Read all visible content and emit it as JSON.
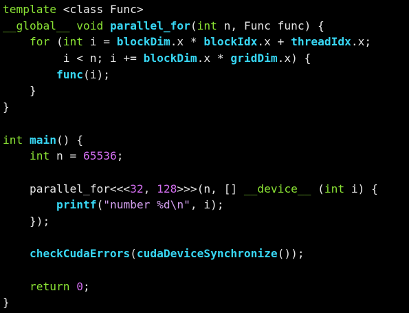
{
  "window": {
    "background": "#000000"
  },
  "colors": {
    "keyword": "#8ae234",
    "function": "#38d8f5",
    "number": "#d36ef0",
    "string": "#d4a0f0",
    "plain": "#e6e6e6"
  },
  "code": {
    "lines": [
      [
        {
          "t": "template",
          "c": "kw"
        },
        {
          "t": " <class Func>",
          "c": "pl"
        }
      ],
      [
        {
          "t": "__global__",
          "c": "kw"
        },
        {
          "t": " ",
          "c": "pl"
        },
        {
          "t": "void",
          "c": "kw"
        },
        {
          "t": " ",
          "c": "pl"
        },
        {
          "t": "parallel_for",
          "c": "fn"
        },
        {
          "t": "(",
          "c": "pl"
        },
        {
          "t": "int",
          "c": "kw"
        },
        {
          "t": " n, Func func) {",
          "c": "pl"
        }
      ],
      [
        {
          "t": "    ",
          "c": "pl"
        },
        {
          "t": "for",
          "c": "kw"
        },
        {
          "t": " (",
          "c": "pl"
        },
        {
          "t": "int",
          "c": "kw"
        },
        {
          "t": " i = ",
          "c": "pl"
        },
        {
          "t": "blockDim",
          "c": "fn"
        },
        {
          "t": ".x * ",
          "c": "pl"
        },
        {
          "t": "blockIdx",
          "c": "fn"
        },
        {
          "t": ".x + ",
          "c": "pl"
        },
        {
          "t": "threadIdx",
          "c": "fn"
        },
        {
          "t": ".x;",
          "c": "pl"
        }
      ],
      [
        {
          "t": "         i < n; i += ",
          "c": "pl"
        },
        {
          "t": "blockDim",
          "c": "fn"
        },
        {
          "t": ".x * ",
          "c": "pl"
        },
        {
          "t": "gridDim",
          "c": "fn"
        },
        {
          "t": ".x) {",
          "c": "pl"
        }
      ],
      [
        {
          "t": "        ",
          "c": "pl"
        },
        {
          "t": "func",
          "c": "fn"
        },
        {
          "t": "(i);",
          "c": "pl"
        }
      ],
      [
        {
          "t": "    }",
          "c": "pl"
        }
      ],
      [
        {
          "t": "}",
          "c": "pl"
        }
      ],
      [
        {
          "t": "",
          "c": "pl"
        }
      ],
      [
        {
          "t": "int",
          "c": "kw"
        },
        {
          "t": " ",
          "c": "pl"
        },
        {
          "t": "main",
          "c": "fn"
        },
        {
          "t": "() {",
          "c": "pl"
        }
      ],
      [
        {
          "t": "    ",
          "c": "pl"
        },
        {
          "t": "int",
          "c": "kw"
        },
        {
          "t": " n = ",
          "c": "pl"
        },
        {
          "t": "65536",
          "c": "num"
        },
        {
          "t": ";",
          "c": "pl"
        }
      ],
      [
        {
          "t": "",
          "c": "pl"
        }
      ],
      [
        {
          "t": "    parallel_for<<<",
          "c": "pl"
        },
        {
          "t": "32",
          "c": "num"
        },
        {
          "t": ", ",
          "c": "pl"
        },
        {
          "t": "128",
          "c": "num"
        },
        {
          "t": ">>>(n, [] ",
          "c": "pl"
        },
        {
          "t": "__device__",
          "c": "kw"
        },
        {
          "t": " (",
          "c": "pl"
        },
        {
          "t": "int",
          "c": "kw"
        },
        {
          "t": " i) {",
          "c": "pl"
        }
      ],
      [
        {
          "t": "        ",
          "c": "pl"
        },
        {
          "t": "printf",
          "c": "fn"
        },
        {
          "t": "(",
          "c": "pl"
        },
        {
          "t": "\"number %d\\n\"",
          "c": "str"
        },
        {
          "t": ", i);",
          "c": "pl"
        }
      ],
      [
        {
          "t": "    });",
          "c": "pl"
        }
      ],
      [
        {
          "t": "",
          "c": "pl"
        }
      ],
      [
        {
          "t": "    ",
          "c": "pl"
        },
        {
          "t": "checkCudaErrors",
          "c": "fn"
        },
        {
          "t": "(",
          "c": "pl"
        },
        {
          "t": "cudaDeviceSynchronize",
          "c": "fn"
        },
        {
          "t": "());",
          "c": "pl"
        }
      ],
      [
        {
          "t": "",
          "c": "pl"
        }
      ],
      [
        {
          "t": "    ",
          "c": "pl"
        },
        {
          "t": "return",
          "c": "kw"
        },
        {
          "t": " ",
          "c": "pl"
        },
        {
          "t": "0",
          "c": "num"
        },
        {
          "t": ";",
          "c": "pl"
        }
      ],
      [
        {
          "t": "}",
          "c": "pl"
        }
      ]
    ]
  }
}
